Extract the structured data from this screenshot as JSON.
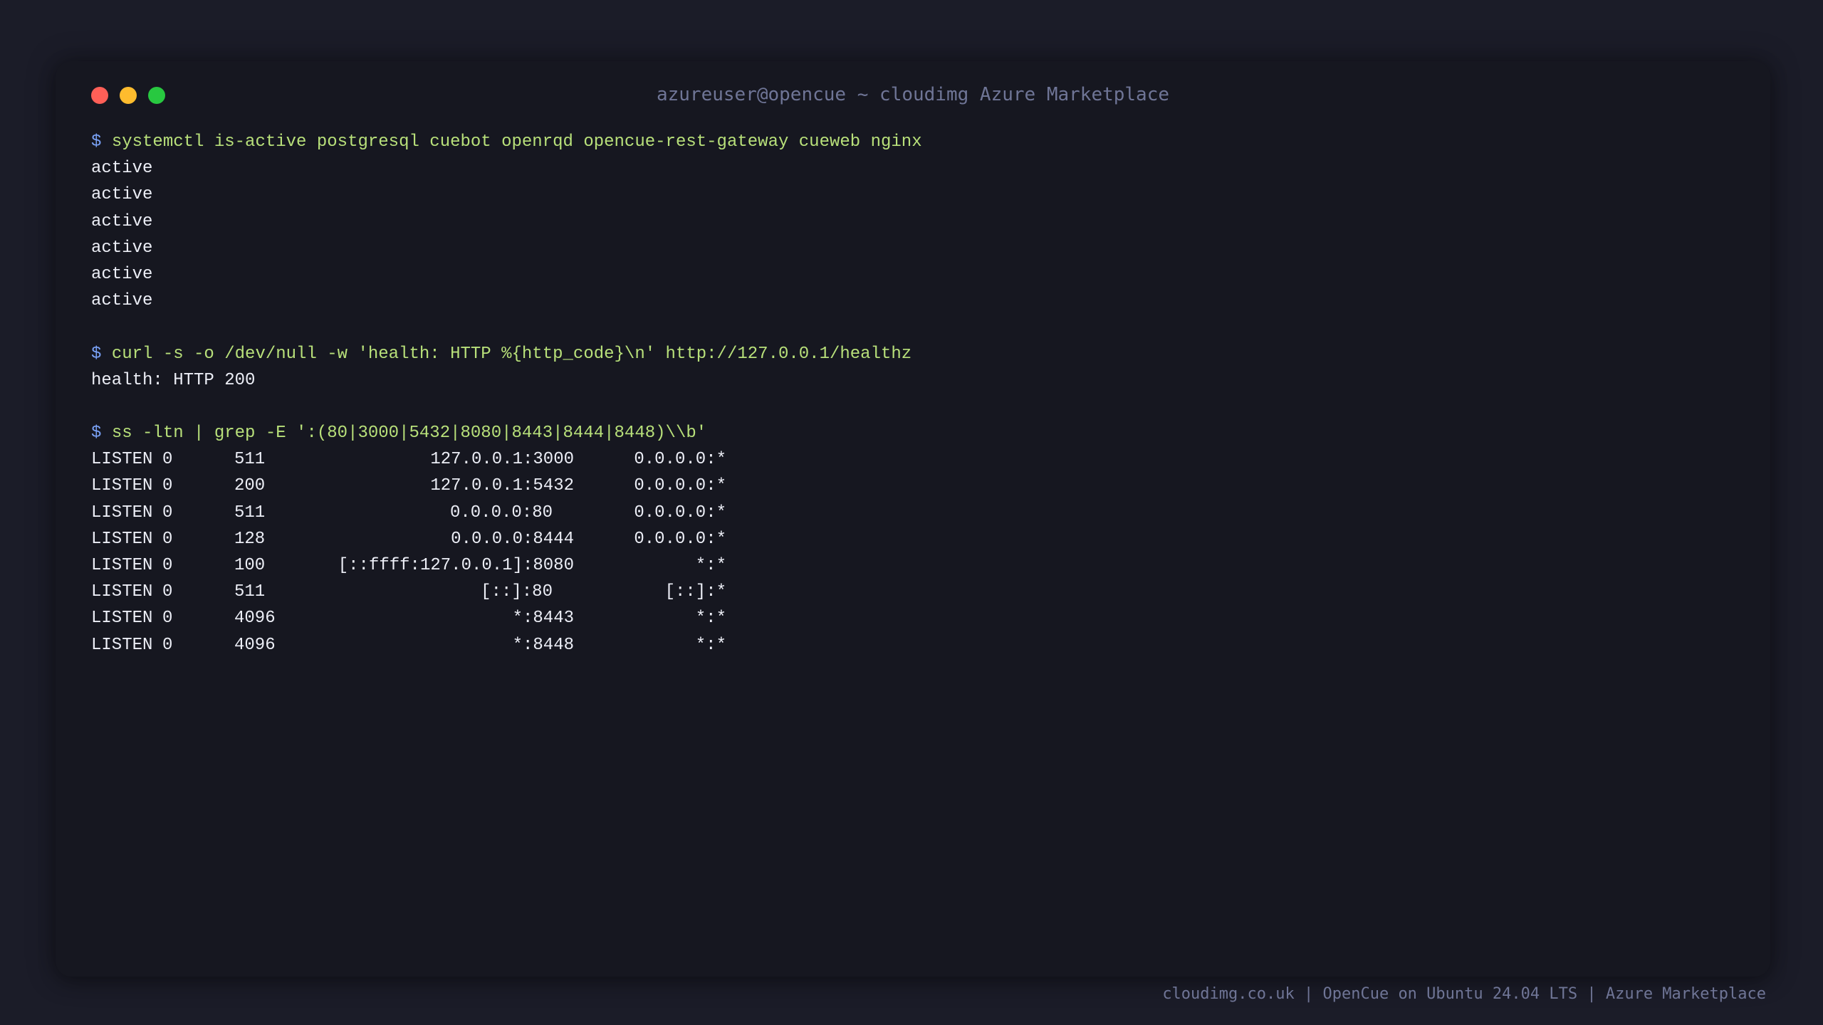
{
  "window": {
    "title": "azureuser@opencue ~ cloudimg Azure Marketplace"
  },
  "terminal": {
    "prompt_symbol": "$",
    "cmd1": {
      "command": "systemctl is-active postgresql cuebot openrqd opencue-rest-gateway cueweb nginx",
      "output": [
        "active",
        "active",
        "active",
        "active",
        "active",
        "active"
      ]
    },
    "cmd2": {
      "command": "curl -s -o /dev/null -w 'health: HTTP %{http_code}\\n' http://127.0.0.1/healthz",
      "output": "health: HTTP 200"
    },
    "cmd3": {
      "command": "ss -ltn | grep -E ':(80|3000|5432|8080|8443|8444|8448)\\\\b'",
      "rows": [
        {
          "state": "LISTEN",
          "recvq": "0",
          "sendq": "511",
          "local": "127.0.0.1:3000",
          "peer": "0.0.0.0:*"
        },
        {
          "state": "LISTEN",
          "recvq": "0",
          "sendq": "200",
          "local": "127.0.0.1:5432",
          "peer": "0.0.0.0:*"
        },
        {
          "state": "LISTEN",
          "recvq": "0",
          "sendq": "511",
          "local": "0.0.0.0:80",
          "peer": "0.0.0.0:*"
        },
        {
          "state": "LISTEN",
          "recvq": "0",
          "sendq": "128",
          "local": "0.0.0.0:8444",
          "peer": "0.0.0.0:*"
        },
        {
          "state": "LISTEN",
          "recvq": "0",
          "sendq": "100",
          "local": "[::ffff:127.0.0.1]:8080",
          "peer": "*:*"
        },
        {
          "state": "LISTEN",
          "recvq": "0",
          "sendq": "511",
          "local": "[::]:80",
          "peer": "[::]:*"
        },
        {
          "state": "LISTEN",
          "recvq": "0",
          "sendq": "4096",
          "local": "*:8443",
          "peer": "*:*"
        },
        {
          "state": "LISTEN",
          "recvq": "0",
          "sendq": "4096",
          "local": "*:8448",
          "peer": "*:*"
        }
      ]
    }
  },
  "footer": {
    "text": "cloudimg.co.uk | OpenCue on Ubuntu 24.04 LTS | Azure Marketplace"
  },
  "colors": {
    "background": "#1b1c28",
    "window": "#161720",
    "prompt": "#7aa2f7",
    "command": "#b8e07a",
    "output": "#eceef6",
    "muted": "#6f7596",
    "close": "#ff5f57",
    "minimize": "#febc2e",
    "maximize": "#28c840"
  }
}
